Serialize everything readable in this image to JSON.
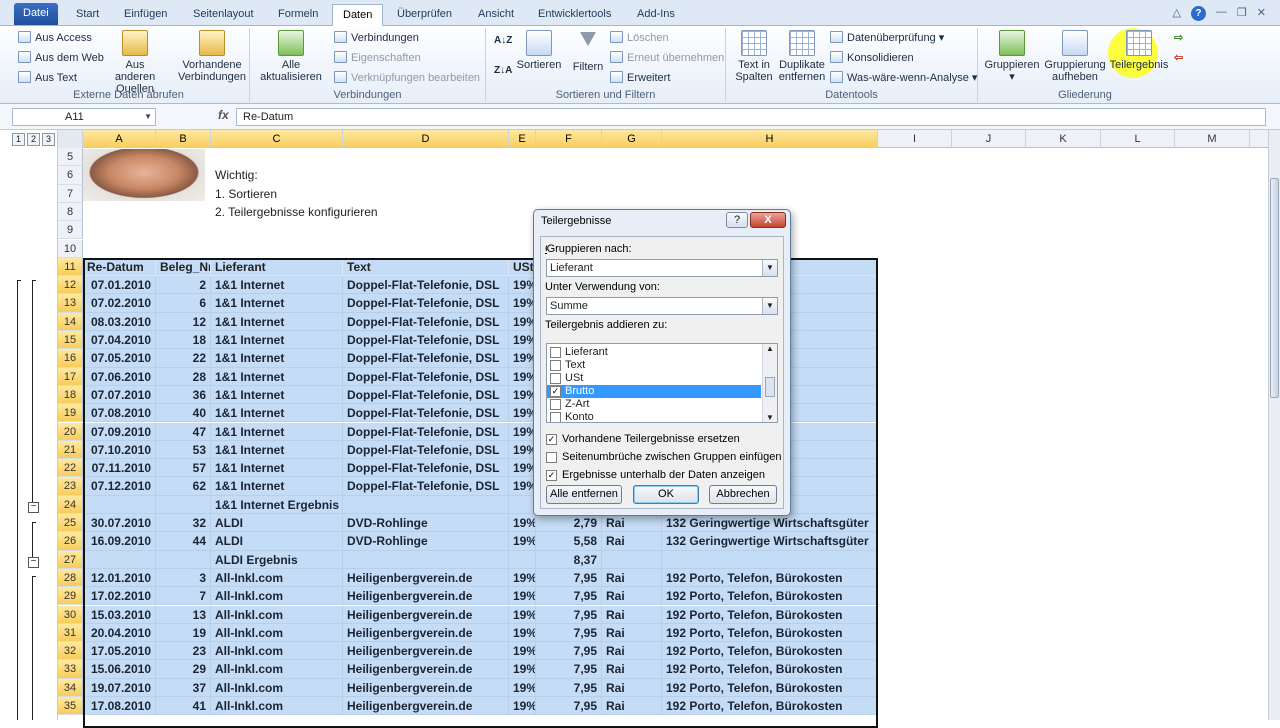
{
  "tabs": [
    "Datei",
    "Start",
    "Einfügen",
    "Seitenlayout",
    "Formeln",
    "Daten",
    "Überprüfen",
    "Ansicht",
    "Entwicklertools",
    "Add-Ins"
  ],
  "active_tab": "Daten",
  "ribbon": {
    "externe": {
      "label": "Externe Daten abrufen",
      "aus_access": "Aus Access",
      "aus_web": "Aus dem Web",
      "aus_text": "Aus Text",
      "aus_anderen_1": "Aus anderen",
      "aus_anderen_2": "Quellen",
      "vorhandene_1": "Vorhandene",
      "vorhandene_2": "Verbindungen"
    },
    "verbindungen": {
      "label": "Verbindungen",
      "alle_1": "Alle",
      "alle_2": "aktualisieren",
      "verbindungen": "Verbindungen",
      "eigenschaften": "Eigenschaften",
      "verkn": "Verknüpfungen bearbeiten"
    },
    "sortieren": {
      "label": "Sortieren und Filtern",
      "sortieren": "Sortieren",
      "filtern": "Filtern",
      "loeschen": "Löschen",
      "erneut": "Erneut übernehmen",
      "erweitert": "Erweitert"
    },
    "datentools": {
      "label": "Datentools",
      "text_1": "Text in",
      "text_2": "Spalten",
      "dup_1": "Duplikate",
      "dup_2": "entfernen",
      "pruef": "Datenüberprüfung",
      "konsol": "Konsolidieren",
      "was": "Was-wäre-wenn-Analyse"
    },
    "gliederung": {
      "label": "Gliederung",
      "gruppieren": "Gruppieren",
      "aufheben_1": "Gruppierung",
      "aufheben_2": "aufheben",
      "teilergebnis": "Teilergebnis"
    }
  },
  "formula_bar": {
    "name_box": "A11",
    "fx": "fx",
    "value": "Re-Datum"
  },
  "outline_levels": [
    "1",
    "2",
    "3"
  ],
  "columns": [
    "A",
    "B",
    "C",
    "D",
    "E",
    "F",
    "G",
    "H",
    "I",
    "J",
    "K",
    "L",
    "M"
  ],
  "notes": {
    "wichtig": "Wichtig:",
    "step1": "1. Sortieren",
    "step2": "2. Teilergebnisse konfigurieren"
  },
  "header_row": {
    "a": "Re-Datum",
    "b": "Beleg_Nr",
    "c": "Lieferant",
    "d": "Text",
    "e": "USt"
  },
  "rows": [
    {
      "n": "12",
      "a": "07.01.2010",
      "b": "2",
      "c": "1&1 Internet",
      "d": "Doppel-Flat-Telefonie, DSL",
      "e": "19%",
      "h": "ürokosten"
    },
    {
      "n": "13",
      "a": "07.02.2010",
      "b": "6",
      "c": "1&1 Internet",
      "d": "Doppel-Flat-Telefonie, DSL",
      "e": "19%",
      "h": "ürokosten"
    },
    {
      "n": "14",
      "a": "08.03.2010",
      "b": "12",
      "c": "1&1 Internet",
      "d": "Doppel-Flat-Telefonie, DSL",
      "e": "19%",
      "h": "ürokosten"
    },
    {
      "n": "15",
      "a": "07.04.2010",
      "b": "18",
      "c": "1&1 Internet",
      "d": "Doppel-Flat-Telefonie, DSL",
      "e": "19%",
      "h": "ürokosten"
    },
    {
      "n": "16",
      "a": "07.05.2010",
      "b": "22",
      "c": "1&1 Internet",
      "d": "Doppel-Flat-Telefonie, DSL",
      "e": "19%",
      "h": "ürokosten"
    },
    {
      "n": "17",
      "a": "07.06.2010",
      "b": "28",
      "c": "1&1 Internet",
      "d": "Doppel-Flat-Telefonie, DSL",
      "e": "19%",
      "h": "ürokosten"
    },
    {
      "n": "18",
      "a": "07.07.2010",
      "b": "36",
      "c": "1&1 Internet",
      "d": "Doppel-Flat-Telefonie, DSL",
      "e": "19%",
      "h": "ürokosten"
    },
    {
      "n": "19",
      "a": "07.08.2010",
      "b": "40",
      "c": "1&1 Internet",
      "d": "Doppel-Flat-Telefonie, DSL",
      "e": "19%",
      "h": "ürokosten"
    },
    {
      "n": "20",
      "a": "07.09.2010",
      "b": "47",
      "c": "1&1 Internet",
      "d": "Doppel-Flat-Telefonie, DSL",
      "e": "19%",
      "h": "ürokosten"
    },
    {
      "n": "21",
      "a": "07.10.2010",
      "b": "53",
      "c": "1&1 Internet",
      "d": "Doppel-Flat-Telefonie, DSL",
      "e": "19%",
      "h": "ürokosten"
    },
    {
      "n": "22",
      "a": "07.11.2010",
      "b": "57",
      "c": "1&1 Internet",
      "d": "Doppel-Flat-Telefonie, DSL",
      "e": "19%",
      "h": "ürokosten"
    },
    {
      "n": "23",
      "a": "07.12.2010",
      "b": "62",
      "c": "1&1 Internet",
      "d": "Doppel-Flat-Telefonie, DSL",
      "e": "19%",
      "h": "ürokosten"
    },
    {
      "n": "24",
      "a": "",
      "b": "",
      "c": "1&1 Internet Ergebnis",
      "d": "",
      "e": "",
      "f": "",
      "g": "",
      "h": ""
    },
    {
      "n": "25",
      "a": "30.07.2010",
      "b": "32",
      "c": "ALDI",
      "d": "DVD-Rohlinge",
      "e": "19%",
      "f": "2,79",
      "g": "Rai",
      "h": "132 Geringwertige Wirtschaftsgüter"
    },
    {
      "n": "26",
      "a": "16.09.2010",
      "b": "44",
      "c": "ALDI",
      "d": "DVD-Rohlinge",
      "e": "19%",
      "f": "5,58",
      "g": "Rai",
      "h": "132 Geringwertige Wirtschaftsgüter"
    },
    {
      "n": "27",
      "a": "",
      "b": "",
      "c": "ALDI Ergebnis",
      "d": "",
      "e": "",
      "f": "8,37",
      "g": "",
      "h": ""
    },
    {
      "n": "28",
      "a": "12.01.2010",
      "b": "3",
      "c": "All-Inkl.com",
      "d": "Heiligenbergverein.de",
      "e": "19%",
      "f": "7,95",
      "g": "Rai",
      "h": "192 Porto, Telefon, Bürokosten"
    },
    {
      "n": "29",
      "a": "17.02.2010",
      "b": "7",
      "c": "All-Inkl.com",
      "d": "Heiligenbergverein.de",
      "e": "19%",
      "f": "7,95",
      "g": "Rai",
      "h": "192 Porto, Telefon, Bürokosten"
    },
    {
      "n": "30",
      "a": "15.03.2010",
      "b": "13",
      "c": "All-Inkl.com",
      "d": "Heiligenbergverein.de",
      "e": "19%",
      "f": "7,95",
      "g": "Rai",
      "h": "192 Porto, Telefon, Bürokosten"
    },
    {
      "n": "31",
      "a": "20.04.2010",
      "b": "19",
      "c": "All-Inkl.com",
      "d": "Heiligenbergverein.de",
      "e": "19%",
      "f": "7,95",
      "g": "Rai",
      "h": "192 Porto, Telefon, Bürokosten"
    },
    {
      "n": "32",
      "a": "17.05.2010",
      "b": "23",
      "c": "All-Inkl.com",
      "d": "Heiligenbergverein.de",
      "e": "19%",
      "f": "7,95",
      "g": "Rai",
      "h": "192 Porto, Telefon, Bürokosten"
    },
    {
      "n": "33",
      "a": "15.06.2010",
      "b": "29",
      "c": "All-Inkl.com",
      "d": "Heiligenbergverein.de",
      "e": "19%",
      "f": "7,95",
      "g": "Rai",
      "h": "192 Porto, Telefon, Bürokosten"
    },
    {
      "n": "34",
      "a": "19.07.2010",
      "b": "37",
      "c": "All-Inkl.com",
      "d": "Heiligenbergverein.de",
      "e": "19%",
      "f": "7,95",
      "g": "Rai",
      "h": "192 Porto, Telefon, Bürokosten"
    },
    {
      "n": "35",
      "a": "17.08.2010",
      "b": "41",
      "c": "All-Inkl.com",
      "d": "Heiligenbergverein.de",
      "e": "19%",
      "f": "7,95",
      "g": "Rai",
      "h": "192 Porto, Telefon, Bürokosten"
    }
  ],
  "top_rows": [
    "5",
    "6",
    "7",
    "8",
    "9",
    "10",
    "11"
  ],
  "dialog": {
    "title": "Teilergebnisse",
    "group_label": "Gruppieren nach:",
    "group_value": "Lieferant",
    "func_label": "Unter Verwendung von:",
    "func_value": "Summe",
    "add_label": "Teilergebnis addieren zu:",
    "list": [
      {
        "label": "Lieferant",
        "checked": false
      },
      {
        "label": "Text",
        "checked": false
      },
      {
        "label": "USt",
        "checked": false
      },
      {
        "label": "Brutto",
        "checked": true
      },
      {
        "label": "Z-Art",
        "checked": false
      },
      {
        "label": "Konto",
        "checked": false
      }
    ],
    "opt_replace": "Vorhandene Teilergebnisse ersetzen",
    "opt_pagebreak": "Seitenumbrüche zwischen Gruppen einfügen",
    "opt_below": "Ergebnisse unterhalb der Daten anzeigen",
    "btn_remove": "Alle entfernen",
    "btn_ok": "OK",
    "btn_cancel": "Abbrechen",
    "help": "?",
    "close": "X"
  }
}
